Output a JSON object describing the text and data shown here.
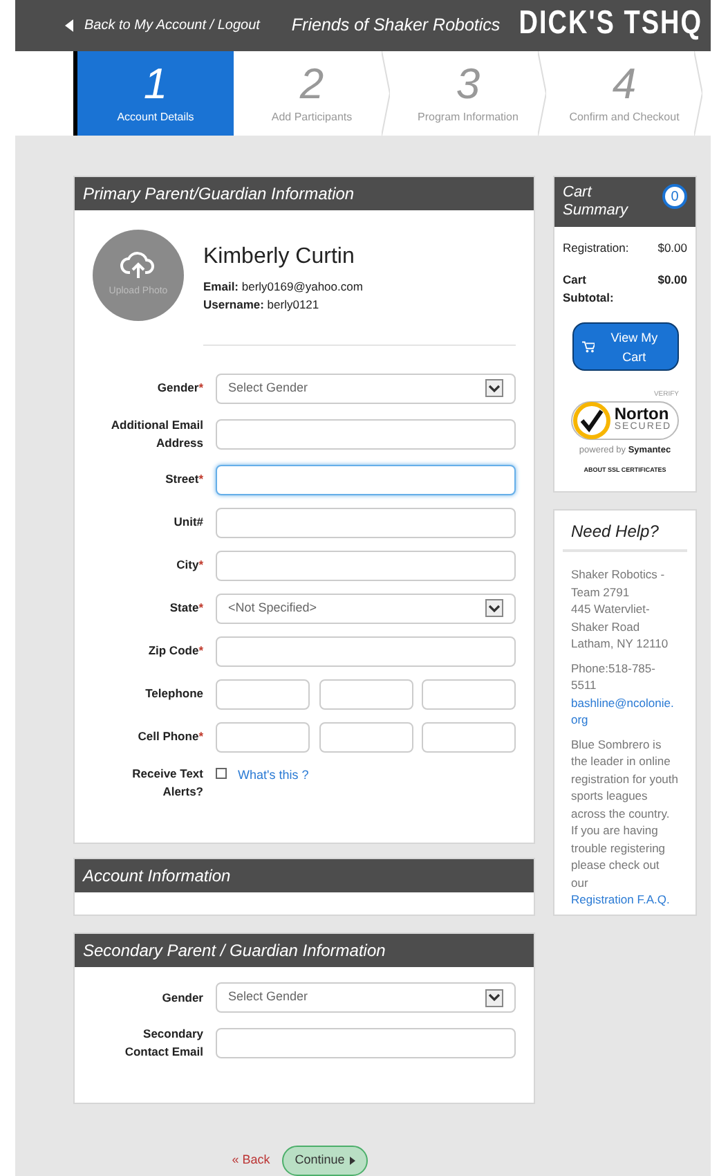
{
  "header": {
    "back_link": "Back to My Account / Logout",
    "title": "Friends of Shaker Robotics",
    "logo": "DICK'S TSHQ"
  },
  "steps": [
    {
      "number": "1",
      "label": "Account Details",
      "selected": true
    },
    {
      "number": "2",
      "label": "Add Participants",
      "selected": false
    },
    {
      "number": "3",
      "label": "Program Information",
      "selected": false
    },
    {
      "number": "4",
      "label": "Confirm and Checkout",
      "selected": false
    }
  ],
  "primary": {
    "title": "Primary Parent/Guardian Information",
    "photo_label": "Upload Photo",
    "name": "Kimberly Curtin",
    "email": "**Email:** berly0169@yahoo.com",
    "username": "**Username:** berly0121",
    "fields": [
      {
        "kind": "select",
        "label": "Gender",
        "required_mark": "*",
        "value": "Select Gender"
      },
      {
        "kind": "text",
        "label": "Additional Email Address",
        "focused": false
      },
      {
        "kind": "text",
        "label": "Street",
        "required_mark": "*",
        "focused": true
      },
      {
        "kind": "text",
        "label": "Unit#",
        "focused": false
      },
      {
        "kind": "text",
        "label": "City",
        "required_mark": "*",
        "focused": false
      },
      {
        "kind": "select",
        "label": "State",
        "required_mark": "*",
        "value": "<Not Specified>"
      },
      {
        "kind": "text",
        "label": "Zip Code",
        "required_mark": "*",
        "focused": false
      },
      {
        "kind": "phone",
        "label": "Telephone"
      },
      {
        "kind": "phone",
        "label": "Cell Phone",
        "required_mark": "*"
      },
      {
        "kind": "checkbox",
        "label": "Receive Text Alerts?",
        "checked": false,
        "link": "What's this ?"
      }
    ]
  },
  "account": {
    "title": "Account Information"
  },
  "secondary": {
    "title": "Secondary Parent / Guardian Information",
    "fields": [
      {
        "kind": "select",
        "label": "Gender",
        "value": "Select Gender"
      },
      {
        "kind": "text",
        "label": "Secondary Contact Email",
        "focused": false
      }
    ]
  },
  "buttons": {
    "back": "« Back",
    "continue": "Continue"
  },
  "cart": {
    "title": "Cart Summary",
    "count": "0",
    "lines": [
      {
        "label": "Registration:",
        "amount": "$0.00",
        "bold": false
      },
      {
        "label": "Cart Subtotal:",
        "amount": "$0.00",
        "bold": true
      }
    ],
    "button": "View My Cart",
    "seal": {
      "verify": "VERIFY",
      "brand": "Norton",
      "secured": "SECURED",
      "powered": "powered by",
      "company": "Symantec",
      "about": "ABOUT SSL CERTIFICATES"
    }
  },
  "help": {
    "title": "Need Help?",
    "address": [
      "Shaker Robotics - Team 2791",
      "445 Watervliet-Shaker Road",
      "Latham, NY 12110"
    ],
    "phone": "Phone:518-785-5511",
    "email": "bashline@ncolonie.org",
    "text": "Blue Sombrero is the leader in online registration for youth sports leagues across the country. If you are having trouble registering please check out our",
    "link": "Registration F.A.Q."
  }
}
